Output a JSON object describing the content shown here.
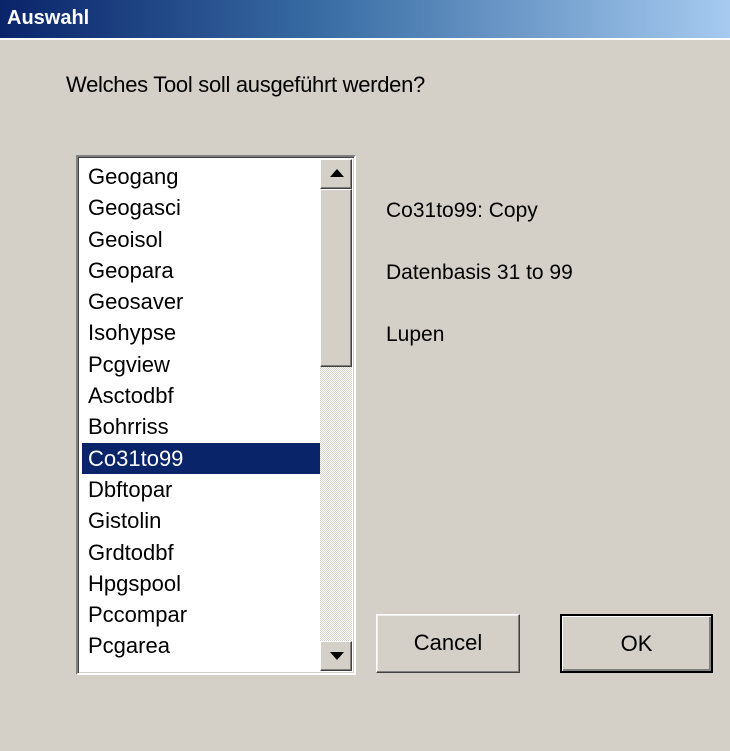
{
  "window": {
    "title": "Auswahl"
  },
  "prompt": "Welches Tool soll ausgeführt werden?",
  "tool_list": {
    "items": [
      "Geogang",
      "Geogasci",
      "Geoisol",
      "Geopara",
      "Geosaver",
      "Isohypse",
      "Pcgview",
      "Asctodbf",
      "Bohrriss",
      "Co31to99",
      "Dbftopar",
      "Gistolin",
      "Grdtodbf",
      "Hpgspool",
      "Pccompar",
      "Pcgarea"
    ],
    "selected_index": 9,
    "selected": "Co31to99"
  },
  "description": {
    "lines": [
      "Co31to99: Copy",
      "Datenbasis 31 to 99",
      "Lupen"
    ]
  },
  "buttons": {
    "cancel_label": "Cancel",
    "ok_label": "OK"
  },
  "colors": {
    "selection_bg": "#0a246a",
    "dialog_bg": "#d4d0c8"
  }
}
